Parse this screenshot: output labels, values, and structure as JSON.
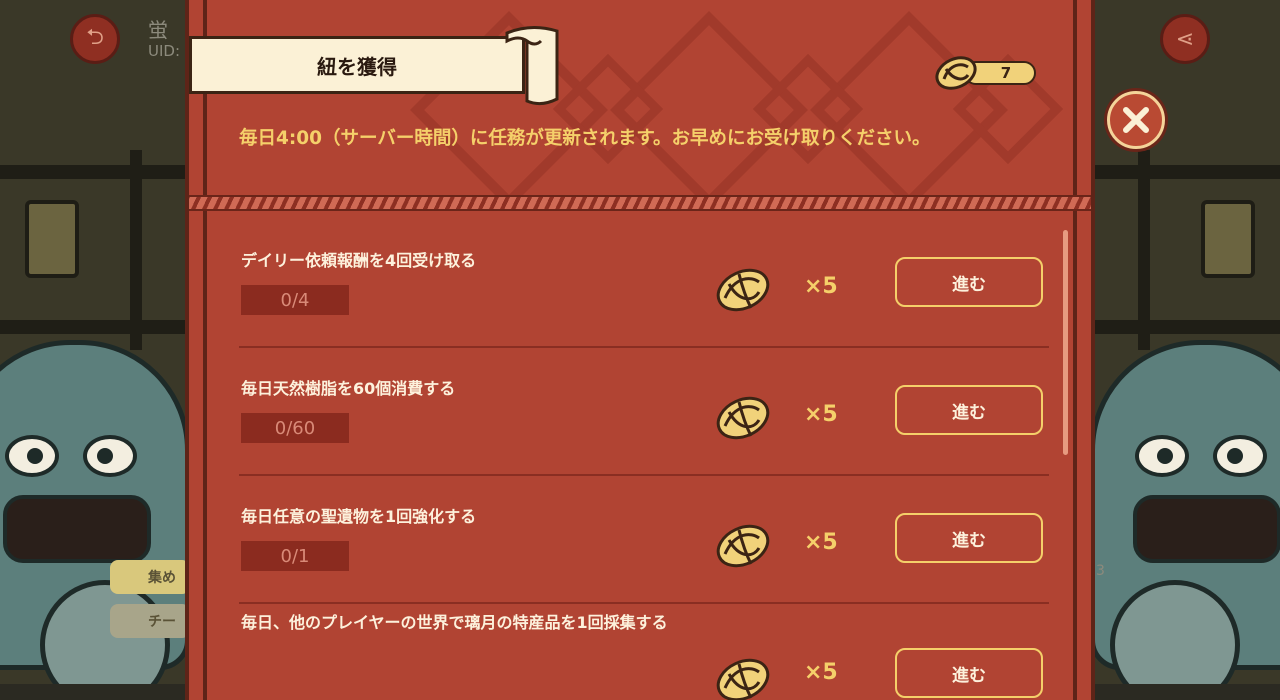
{
  "background": {
    "name_text": "蛍",
    "uid_label": "UID:",
    "side_tab_1": "集め",
    "side_tab_2": "チー",
    "right_number": "3"
  },
  "panel": {
    "title": "紐を獲得",
    "currency_amount": "7",
    "notice": "毎日4:00（サーバー時間）に任務が更新されます。お早めにお受け取りください。"
  },
  "tasks": [
    {
      "name": "デイリー依頼報酬を4回受け取る",
      "progress": "0/4",
      "reward_qty": "×5",
      "button": "進む"
    },
    {
      "name": "毎日天然樹脂を60個消費する",
      "progress": "0/60",
      "reward_qty": "×5",
      "button": "進む"
    },
    {
      "name": "毎日任意の聖遺物を1回強化する",
      "progress": "0/1",
      "reward_qty": "×5",
      "button": "進む"
    },
    {
      "name": "毎日、他のプレイヤーの世界で璃月の特産品を1回採集する",
      "progress": "",
      "reward_qty": "×5",
      "button": "進む"
    }
  ],
  "colors": {
    "panel": "#b14433",
    "accent": "#f5d06a",
    "text": "#fdf1dc"
  },
  "icons": {
    "close": "close-icon",
    "knot": "knot-icon",
    "back": "back-arrow-icon",
    "share": "share-icon"
  }
}
